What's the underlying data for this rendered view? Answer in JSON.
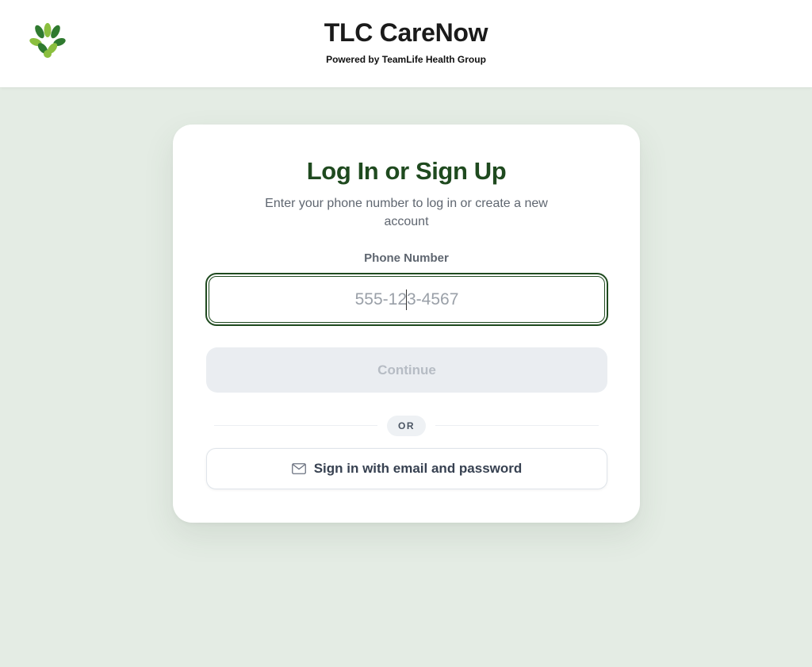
{
  "header": {
    "title": "TLC CareNow",
    "subtitle": "Powered by TeamLife Health Group",
    "logo_icon": "leaf-cluster-logo-icon"
  },
  "colors": {
    "background": "#e4ece4",
    "brand_green": "#1f4a1f",
    "logo_light": "#8bbf3f",
    "logo_dark": "#2f7a2f"
  },
  "login": {
    "title": "Log In or Sign Up",
    "subtitle": "Enter your phone number to log in or create a new account",
    "phone_label": "Phone Number",
    "phone_placeholder": "555-123-4567",
    "phone_value": "",
    "continue_label": "Continue",
    "or_label": "OR",
    "email_button_label": "Sign in with email and password",
    "email_icon": "mail-icon"
  }
}
